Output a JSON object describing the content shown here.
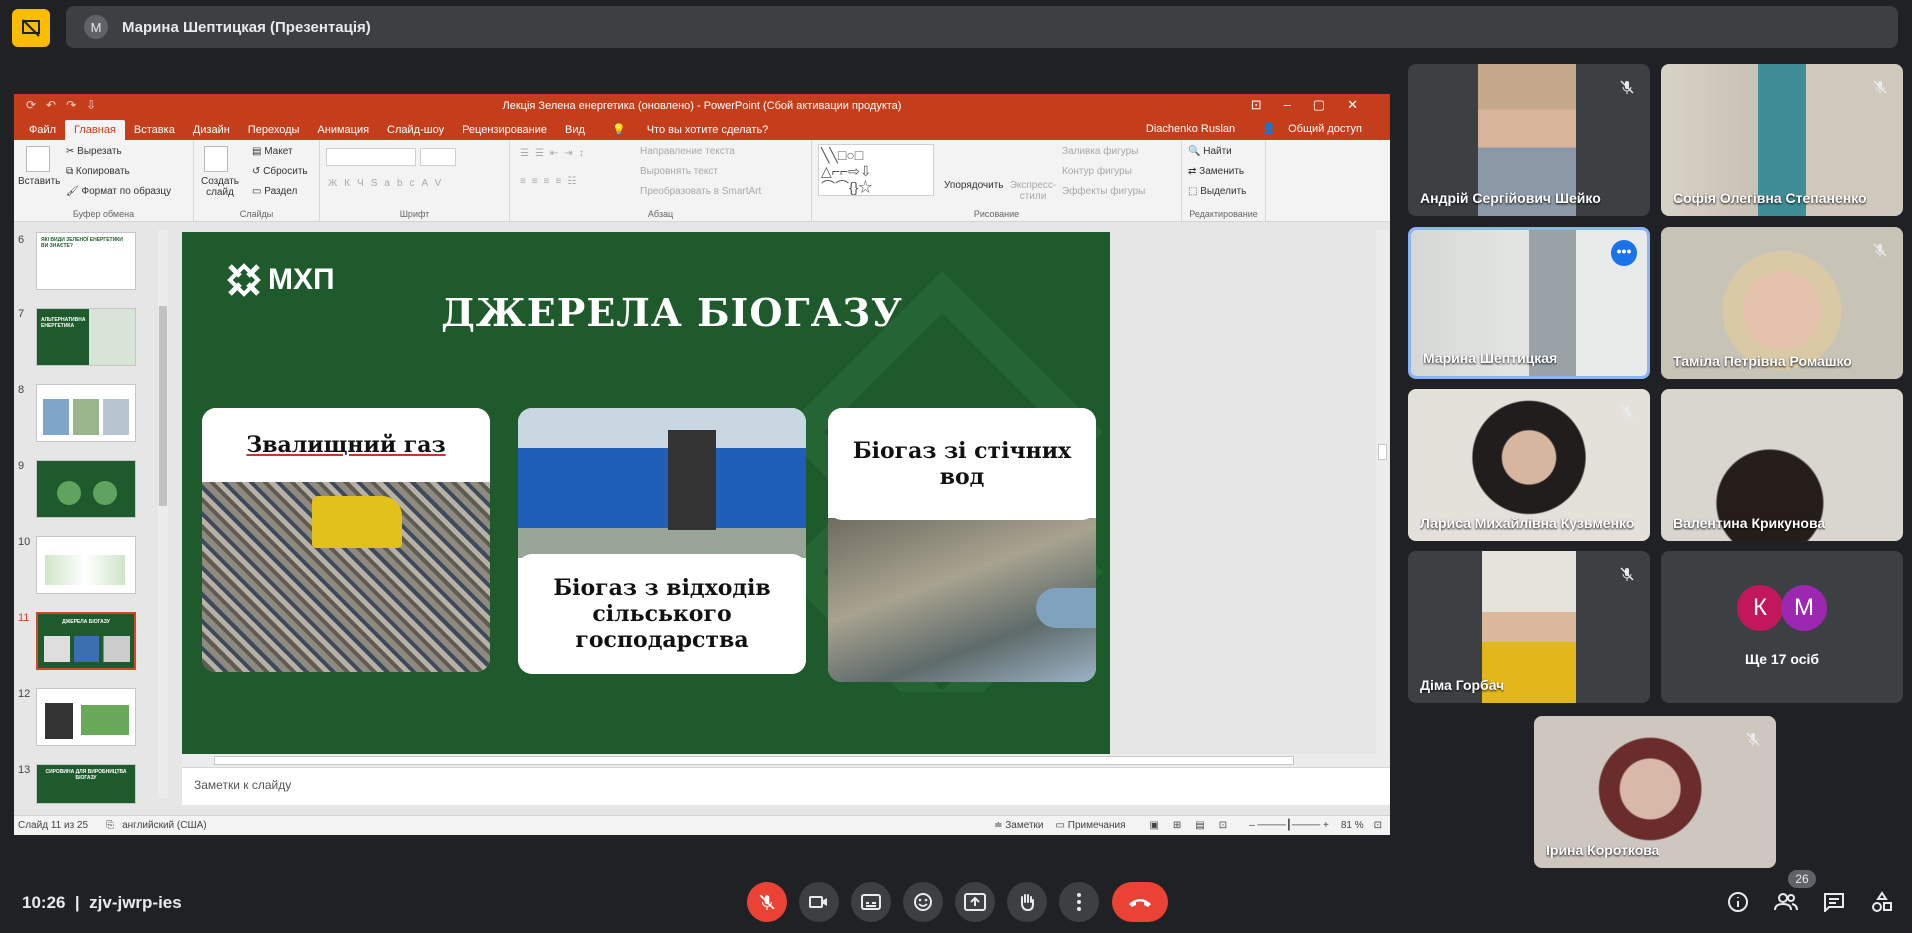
{
  "meeting": {
    "presenter_initial": "M",
    "presenter_title": "Марина Шептицкая (Презентація)",
    "time": "10:26",
    "code": "zjv-jwrp-ies",
    "participants_count": "26"
  },
  "ppt": {
    "window_title": "Лекція Зелена енергетика (оновлено) - PowerPoint (Сбой активации продукта)",
    "user": "Diachenko Ruslan",
    "share": "Общий доступ",
    "tabs": [
      "Файл",
      "Главная",
      "Вставка",
      "Дизайн",
      "Переходы",
      "Анимация",
      "Слайд-шоу",
      "Рецензирование",
      "Вид"
    ],
    "tell_me": "Что вы хотите сделать?",
    "ribbon": {
      "clipboard": {
        "label": "Буфер обмена",
        "paste": "Вставить",
        "cut": "Вырезать",
        "copy": "Копировать",
        "format": "Формат по образцу"
      },
      "slides": {
        "label": "Слайды",
        "new_slide": "Создать слайд",
        "layout": "Макет",
        "reset": "Сбросить",
        "section": "Раздел"
      },
      "font": {
        "label": "Шрифт"
      },
      "paragraph": {
        "label": "Абзац",
        "dir": "Направление текста",
        "align": "Выровнять текст",
        "smartart": "Преобразовать в SmartArt"
      },
      "drawing": {
        "label": "Рисование",
        "arrange": "Упорядочить",
        "styles": "Экспресс-стили",
        "fill": "Заливка фигуры",
        "outline": "Контур фигуры",
        "effects": "Эффекты фигуры"
      },
      "editing": {
        "label": "Редактирование",
        "find": "Найти",
        "replace": "Заменить",
        "select": "Выделить"
      }
    },
    "thumb_numbers": [
      "6",
      "7",
      "8",
      "9",
      "10",
      "11",
      "12",
      "13"
    ],
    "thumb_texts": {
      "t6": "ЯКІ ВИДИ ЗЕЛЕНОЇ ЕНЕРГЕТИКИ ВИ ЗНАЄТЕ?",
      "t7": "АЛЬТЕРНАТИВНА ЕНЕРГЕТИКА",
      "t11": "ДЖЕРЕЛА БІОГАЗУ",
      "t13": "СИРОВИНА ДЛЯ ВИРОБНИЦТВА БІОГАЗУ"
    },
    "slide": {
      "logo": "МХП",
      "title": "ДЖЕРЕЛА БІОГАЗУ",
      "card1": "Звалищний газ",
      "card2": "Біогаз з відходів сільського господарства",
      "card3": "Біогаз зі стічних вод"
    },
    "notes_placeholder": "Заметки к слайду",
    "status": {
      "slide_of": "Слайд 11 из 25",
      "language": "английский (США)",
      "notes": "Заметки",
      "comments": "Примечания",
      "zoom": "81 %"
    }
  },
  "participants": [
    {
      "name": "Андрій Сергійович Шейко"
    },
    {
      "name": "Софія Олегівна Степаненко"
    },
    {
      "name": "Марина Шептицкая"
    },
    {
      "name": "Таміла Петрівна Ромашко"
    },
    {
      "name": "Лариса Михайлівна Кузьменко"
    },
    {
      "name": "Валентина Крикунова"
    },
    {
      "name": "Діма Горбач"
    },
    {
      "name": "Ірина Короткова"
    }
  ],
  "more_tile": {
    "initial1": "К",
    "initial2": "М",
    "text": "Ще 17 осіб",
    "color1": "#c2185b",
    "color2": "#9c27b0"
  },
  "colors": {
    "ppt_accent": "#c43e1c",
    "slide_green": "#1e5a2c",
    "end_call": "#ea4335",
    "active_speaker": "#8ab4f8"
  }
}
